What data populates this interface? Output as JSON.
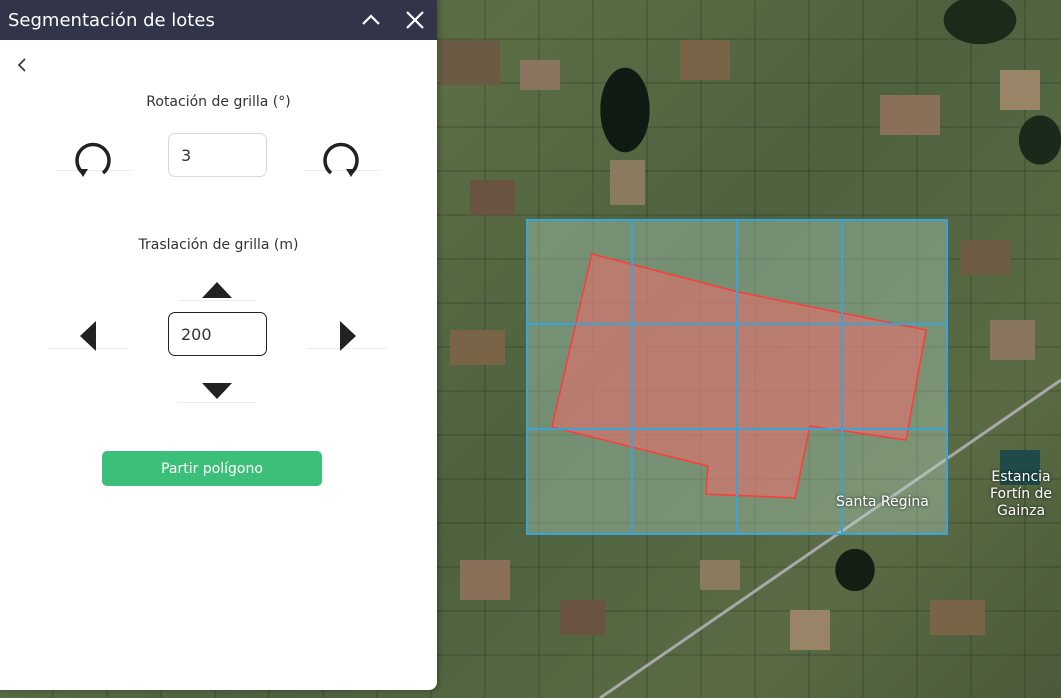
{
  "panel": {
    "title": "Segmentación de lotes",
    "rotation": {
      "label": "Rotación de grilla (°)",
      "value": "3"
    },
    "translation": {
      "label": "Traslación de grilla (m)",
      "value": "200"
    },
    "split_button": "Partir polígono"
  },
  "map": {
    "place_label_1": "Santa Regina",
    "place_label_2": "Estancia\nFortín de\nGainza"
  },
  "colors": {
    "header_bg": "#32344a",
    "button_green": "#3cbf78",
    "grid_line": "#3aa3d8",
    "polygon_fill": "#f08080",
    "polygon_stroke": "#ff3b3b"
  },
  "icons": {
    "header_collapse": "chevron-up-icon",
    "header_close": "close-icon",
    "back": "chevron-left-icon",
    "rotate_left": "rotate-ccw-icon",
    "rotate_right": "rotate-cw-icon",
    "move_up": "arrow-up-icon",
    "move_down": "arrow-down-icon",
    "move_left": "arrow-left-icon",
    "move_right": "arrow-right-icon"
  }
}
